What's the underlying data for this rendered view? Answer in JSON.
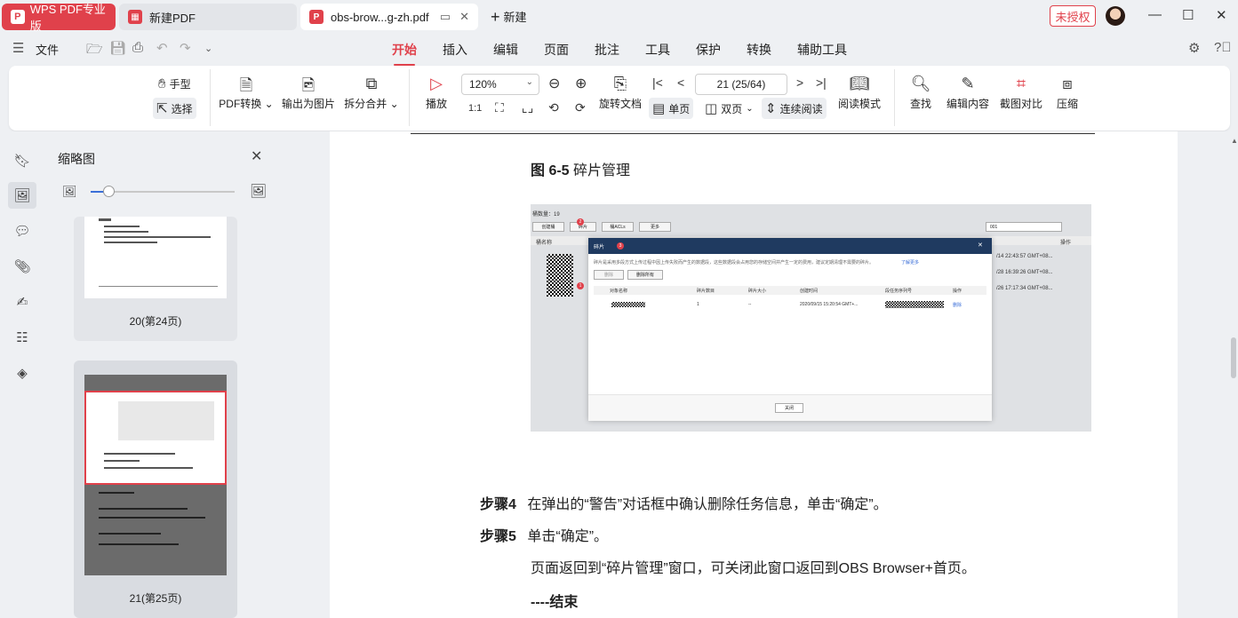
{
  "titlebar": {
    "app_name": "WPS PDF专业版",
    "tabs": [
      {
        "label": "新建PDF"
      },
      {
        "label": "obs-brow...g-zh.pdf"
      }
    ],
    "new_tab": "新建",
    "unlicensed": "未授权"
  },
  "menubar": {
    "file": "文件",
    "tabs": [
      "开始",
      "插入",
      "编辑",
      "页面",
      "批注",
      "工具",
      "保护",
      "转换",
      "辅助工具"
    ],
    "active_tab": "开始"
  },
  "toolbar": {
    "hand": "手型",
    "select": "选择",
    "pdf_convert": "PDF转换",
    "export_image": "输出为图片",
    "split_merge": "拆分合并",
    "play": "播放",
    "zoom": "120%",
    "page_input": "21 (25/64)",
    "rotate": "旋转文档",
    "single": "单页",
    "double": "双页",
    "continuous": "连续阅读",
    "read_mode": "阅读模式",
    "find": "查找",
    "edit_content": "编辑内容",
    "screenshot_compare": "截图对比",
    "compress": "压缩"
  },
  "thumbnails": {
    "title": "缩略图",
    "zoom_level": 0.14,
    "items": [
      {
        "label": "20(第24页)"
      },
      {
        "label": "21(第25页)",
        "selected": true
      }
    ]
  },
  "document": {
    "figure_label": "图 6-5",
    "figure_title": "碎片管理",
    "steps": [
      {
        "label": "步骤4",
        "text": "在弹出的“警告”对话框中确认删除任务信息，单击“确定”。"
      },
      {
        "label": "步骤5",
        "text": "单击“确定”。"
      },
      {
        "label": "",
        "text": "页面返回到“碎片管理”窗口，可关闭此窗口返回到OBS Browser+首页。"
      }
    ],
    "end": "----结束",
    "screenshot": {
      "bucket_count": "桶数量：19",
      "btn_create": "创建桶",
      "btn_fragment": "碎片",
      "btn_acl": "桶ACLs",
      "btn_more": "更多",
      "search_value": "001",
      "col_bucket": "桶名称",
      "col_op": "操作",
      "row_times": [
        "/14 22:43:57 GMT+08...",
        "/28 16:39:26 GMT+08...",
        "/26 17:17:34 GMT+08..."
      ],
      "dialog_title": "碎片",
      "dialog_desc": "碎片是采用多段方式上传过程中因上传失败而产生的数据段，这些数据段会占用您的存储空间并产生一定的费用，建议定期清理不需要的碎片。",
      "learn_more": "了解更多",
      "btn_delete": "删除",
      "btn_delete_all": "删除所有",
      "headers": [
        "对象名称",
        "碎片数目",
        "碎片大小",
        "创建时间",
        "段任务序列号",
        "操作"
      ],
      "row": {
        "count": "1",
        "size": "--",
        "time": "2020/09/15 15:20:54 GMT+...",
        "op": "删除"
      },
      "btn_close": "关闭",
      "badges": [
        "2",
        "3",
        "1"
      ]
    }
  },
  "colors": {
    "accent": "#e0414b",
    "link": "#3b6fd8"
  }
}
